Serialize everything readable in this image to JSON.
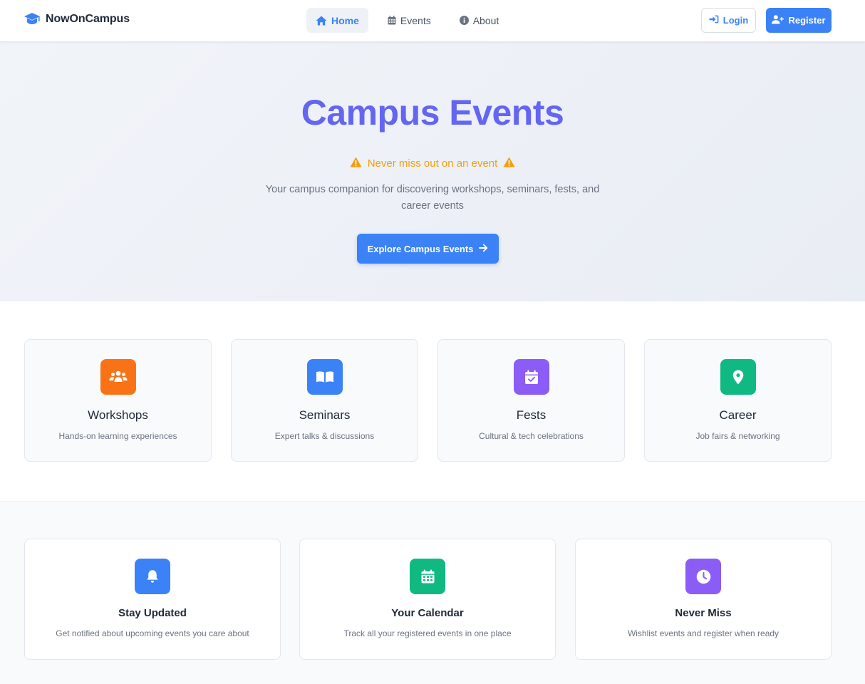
{
  "navbar": {
    "brand": "NowOnCampus",
    "links": [
      {
        "label": "Home",
        "icon": "home-icon",
        "active": true
      },
      {
        "label": "Events",
        "icon": "calendar-icon",
        "active": false
      },
      {
        "label": "About",
        "icon": "info-icon",
        "active": false
      }
    ],
    "login_label": "Login",
    "register_label": "Register"
  },
  "hero": {
    "title": "Campus Events",
    "tagline": "Never miss out on an event",
    "description": "Your campus companion for discovering workshops, seminars, fests, and career events",
    "cta_label": "Explore Campus Events"
  },
  "categories": [
    {
      "title": "Workshops",
      "subtitle": "Hands-on learning experiences",
      "icon": "users-icon",
      "color": "#f97316"
    },
    {
      "title": "Seminars",
      "subtitle": "Expert talks & discussions",
      "icon": "book-open-icon",
      "color": "#3b82f6"
    },
    {
      "title": "Fests",
      "subtitle": "Cultural & tech celebrations",
      "icon": "calendar-check-icon",
      "color": "#8b5cf6"
    },
    {
      "title": "Career",
      "subtitle": "Job fairs & networking",
      "icon": "map-pin-icon",
      "color": "#10b981"
    }
  ],
  "features": [
    {
      "title": "Stay Updated",
      "subtitle": "Get notified about upcoming events you care about",
      "icon": "bell-icon",
      "color": "#3b82f6"
    },
    {
      "title": "Your Calendar",
      "subtitle": "Track all your registered events in one place",
      "icon": "calendar-grid-icon",
      "color": "#10b981"
    },
    {
      "title": "Never Miss",
      "subtitle": "Wishlist events and register when ready",
      "icon": "clock-icon",
      "color": "#8b5cf6"
    }
  ],
  "colors": {
    "primary": "#3b82f6",
    "hero_title": "#6366f1",
    "warning": "#f59e0b"
  }
}
